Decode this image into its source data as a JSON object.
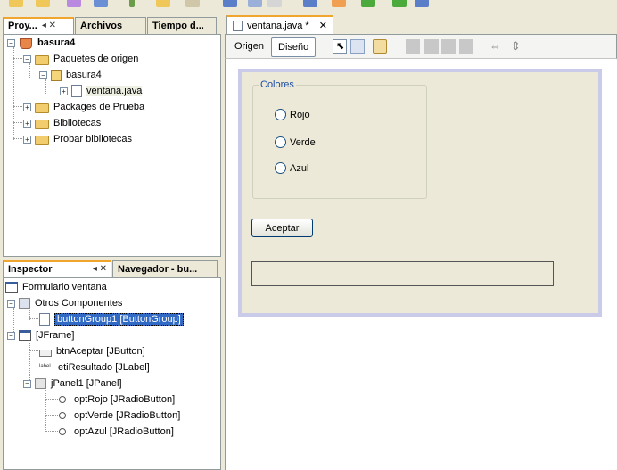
{
  "colors": {
    "accent_tab": "#f0a52f",
    "selection": "#316ac5",
    "legend": "#1f4ea5"
  },
  "top_toolbar": {
    "icons": [
      "new-file-icon",
      "open-project-icon",
      "save-icon",
      "build-icon",
      "debug-icon",
      "run-icon"
    ]
  },
  "projects_panel": {
    "tabs": [
      {
        "label": "Proy...",
        "active": true,
        "controls": "◂ ✕"
      },
      {
        "label": "Archivos",
        "active": false,
        "controls": ""
      },
      {
        "label": "Tiempo d...",
        "active": false,
        "controls": ""
      }
    ],
    "tree": [
      {
        "label": "basura4",
        "bold": true,
        "icon": "java-project-icon"
      },
      {
        "label": "Paquetes de origen",
        "icon": "folder-icon"
      },
      {
        "label": "basura4",
        "icon": "package-icon"
      },
      {
        "label": "ventana.java",
        "icon": "java-form-icon"
      },
      {
        "label": "Packages de Prueba",
        "icon": "folder-icon"
      },
      {
        "label": "Bibliotecas",
        "icon": "folder-icon"
      },
      {
        "label": "Probar bibliotecas",
        "icon": "folder-icon"
      }
    ]
  },
  "inspector_panel": {
    "tabs": [
      {
        "label": "Inspector",
        "active": true,
        "controls": "◂ ✕"
      },
      {
        "label": "Navegador - bu...",
        "active": false,
        "controls": ""
      }
    ],
    "tree": [
      {
        "label": "Formulario ventana",
        "icon": "form-icon"
      },
      {
        "label": "Otros Componentes",
        "icon": "components-icon"
      },
      {
        "label": "buttonGroup1 [ButtonGroup]",
        "icon": "buttongroup-icon",
        "selected": true
      },
      {
        "label": "[JFrame]",
        "icon": "jframe-icon"
      },
      {
        "label": "btnAceptar [JButton]",
        "icon": "jbutton-icon"
      },
      {
        "label": "etiResultado [JLabel]",
        "icon": "jlabel-icon"
      },
      {
        "label": "jPanel1 [JPanel]",
        "icon": "jpanel-icon"
      },
      {
        "label": "optRojo [JRadioButton]",
        "icon": "jradiobutton-icon"
      },
      {
        "label": "optVerde [JRadioButton]",
        "icon": "jradiobutton-icon"
      },
      {
        "label": "optAzul [JRadioButton]",
        "icon": "jradiobutton-icon"
      }
    ]
  },
  "editor": {
    "tab_label": "ventana.java *",
    "mode_source": "Origen",
    "mode_design": "Diseño",
    "toolbar_icons": [
      "selection-mode-icon",
      "connection-mode-icon",
      "preview-design-icon",
      "align-left-icon",
      "align-right-icon",
      "align-top-icon",
      "align-bottom-icon",
      "resize-horizontal-icon",
      "resize-vertical-icon"
    ],
    "form": {
      "group_title": "Colores",
      "radios": [
        "Rojo",
        "Verde",
        "Azul"
      ],
      "button_label": "Aceptar",
      "result_text": ""
    }
  }
}
